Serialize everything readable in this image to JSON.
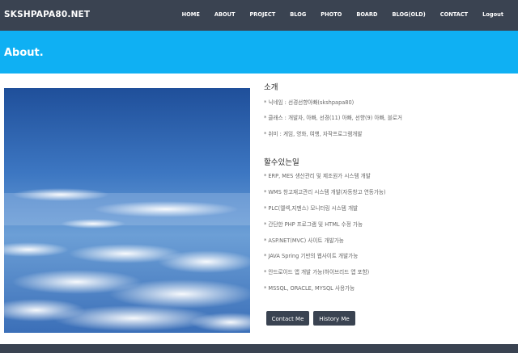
{
  "header": {
    "brand": "SKSHPAPA80.NET",
    "nav": [
      "HOME",
      "ABOUT",
      "PROJECT",
      "BLOG",
      "PHOTO",
      "BOARD",
      "BLOG(OLD)",
      "CONTACT",
      "Logout"
    ]
  },
  "hero": {
    "title": "About."
  },
  "intro": {
    "title": "소개",
    "items": [
      "* 닉네임 : 선경선향아빠(skshpapa80)",
      "* 클래스 : 개발자, 아빠, 선경(11) 아빠, 선향(9) 아빠, 블로거",
      "* 취미 : 게임, 영화, 여행, 자작프로그램개발"
    ]
  },
  "skills": {
    "title": "할수있는일",
    "items": [
      "* ERP, MES 생산관리 및 제조원가 시스템 개발",
      "* WMS 창고재고관리 시스템 개발(자동창고 연동가능)",
      "* PLC(멜섹,지멘스) 모니터링 시스템 개발",
      "* 간단한 PHP 프로그램 및 HTML 수정 가능",
      "* ASP.NET(MVC) 사이트 개발가능",
      "* JAVA Spring 기반의 웹사이트 개발가능",
      "* 안드로이드 앱 개발 가능(하이브리드 앱 포함)",
      "* MSSQL, ORACLE, MYSQL 사용가능"
    ]
  },
  "buttons": {
    "contact": "Contact Me",
    "history": "History Me"
  },
  "colors": {
    "navbar": "#3a4351",
    "hero": "#0fb0f3",
    "button": "#3a4351"
  }
}
